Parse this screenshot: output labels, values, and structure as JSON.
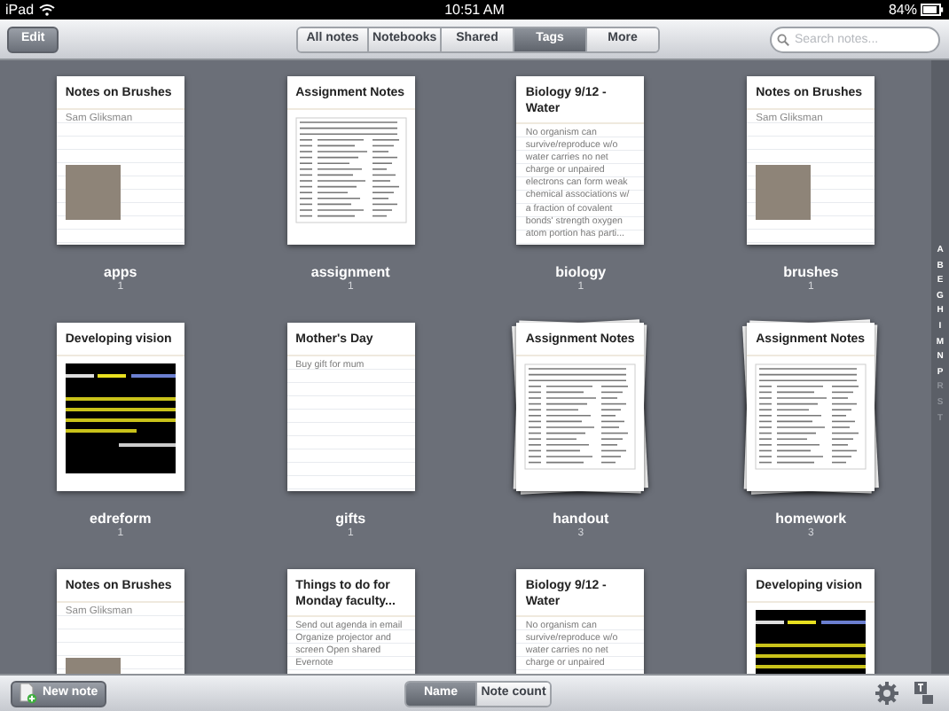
{
  "status_bar": {
    "device": "iPad",
    "time": "10:51 AM",
    "battery": "84%"
  },
  "toolbar": {
    "edit_button": "Edit",
    "tabs": [
      {
        "label": "All notes",
        "selected": false
      },
      {
        "label": "Notebooks",
        "selected": false
      },
      {
        "label": "Shared",
        "selected": false
      },
      {
        "label": "Tags",
        "selected": true
      },
      {
        "label": "More",
        "selected": false
      }
    ],
    "search": {
      "placeholder": "Search notes..."
    }
  },
  "tags": [
    {
      "name": "apps",
      "count": "1",
      "stacked": false,
      "preview": {
        "kind": "photo",
        "title": "Notes on Brushes",
        "subtitle": "Sam Gliksman"
      }
    },
    {
      "name": "assignment",
      "count": "1",
      "stacked": false,
      "preview": {
        "kind": "document",
        "title": "Assignment Notes"
      }
    },
    {
      "name": "biology",
      "count": "1",
      "stacked": false,
      "preview": {
        "kind": "text",
        "title": "Biology 9/12 - Water",
        "body": "No organism can survive/reproduce w/o water carries no net charge or unpaired electrons can form weak chemical associations w/ a fraction of covalent bonds' strength oxygen atom portion has parti..."
      }
    },
    {
      "name": "brushes",
      "count": "1",
      "stacked": false,
      "preview": {
        "kind": "photo",
        "title": "Notes on Brushes",
        "subtitle": "Sam Gliksman"
      }
    },
    {
      "name": "edreform",
      "count": "1",
      "stacked": false,
      "preview": {
        "kind": "slide",
        "title": "Developing vision"
      }
    },
    {
      "name": "gifts",
      "count": "1",
      "stacked": false,
      "preview": {
        "kind": "text",
        "title": "Mother's Day",
        "body": "Buy gift for mum"
      }
    },
    {
      "name": "handout",
      "count": "3",
      "stacked": true,
      "preview": {
        "kind": "document",
        "title": "Assignment Notes"
      }
    },
    {
      "name": "homework",
      "count": "3",
      "stacked": true,
      "preview": {
        "kind": "document",
        "title": "Assignment Notes"
      }
    },
    {
      "stacked": false,
      "preview": {
        "kind": "photo",
        "title": "Notes on Brushes",
        "subtitle": "Sam Gliksman"
      }
    },
    {
      "stacked": false,
      "preview": {
        "kind": "text",
        "title": "Things to do for Monday faculty...",
        "body": "Send out agenda in email Organize projector and screen Open shared Evernote"
      }
    },
    {
      "stacked": false,
      "preview": {
        "kind": "text",
        "title": "Biology 9/12 - Water",
        "body": "No organism can survive/reproduce w/o water carries no net charge or unpaired"
      }
    },
    {
      "stacked": false,
      "preview": {
        "kind": "slide",
        "title": "Developing vision"
      }
    }
  ],
  "index_letters": [
    {
      "letter": "A",
      "disabled": false
    },
    {
      "letter": "B",
      "disabled": false
    },
    {
      "letter": "E",
      "disabled": false
    },
    {
      "letter": "G",
      "disabled": false
    },
    {
      "letter": "H",
      "disabled": false
    },
    {
      "letter": "I",
      "disabled": false
    },
    {
      "letter": "M",
      "disabled": false
    },
    {
      "letter": "N",
      "disabled": false
    },
    {
      "letter": "P",
      "disabled": false
    },
    {
      "letter": "R",
      "disabled": true
    },
    {
      "letter": "S",
      "disabled": true
    },
    {
      "letter": "T",
      "disabled": true
    }
  ],
  "bottom_bar": {
    "new_note_button": "New note",
    "sort": [
      {
        "label": "Name",
        "selected": true
      },
      {
        "label": "Note count",
        "selected": false
      }
    ]
  }
}
